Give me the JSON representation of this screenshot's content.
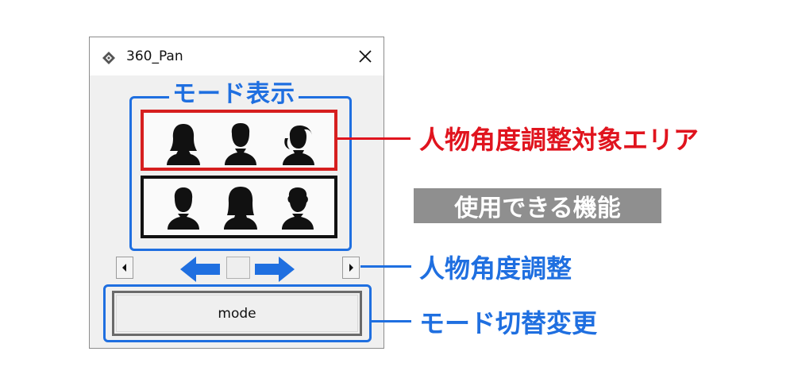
{
  "window": {
    "title": "360_Pan",
    "icon": "diamond-app-icon",
    "close_icon": "close-icon"
  },
  "mode_display": {
    "label": "モード表示",
    "top_row_people": [
      "person-long-hair-icon",
      "person-short-hair-icon",
      "person-ponytail-icon"
    ],
    "bottom_row_people": [
      "person-icon",
      "person-bob-hair-icon",
      "person-curly-hair-icon"
    ]
  },
  "scrollbar": {
    "left_icon": "scroll-left-arrow-icon",
    "right_icon": "scroll-right-arrow-icon",
    "left_blue_arrow": "left-arrow-icon",
    "right_blue_arrow": "right-arrow-icon"
  },
  "mode_button": {
    "label": "mode"
  },
  "annotations": {
    "target_area": "人物角度調整対象エリア",
    "features_header": "使用できる機能",
    "angle_adjust": "人物角度調整",
    "mode_switch": "モード切替変更"
  },
  "colors": {
    "accent_blue": "#1f6fe0",
    "accent_red": "#e0141e",
    "feature_box_bg": "#8f8f8f"
  }
}
